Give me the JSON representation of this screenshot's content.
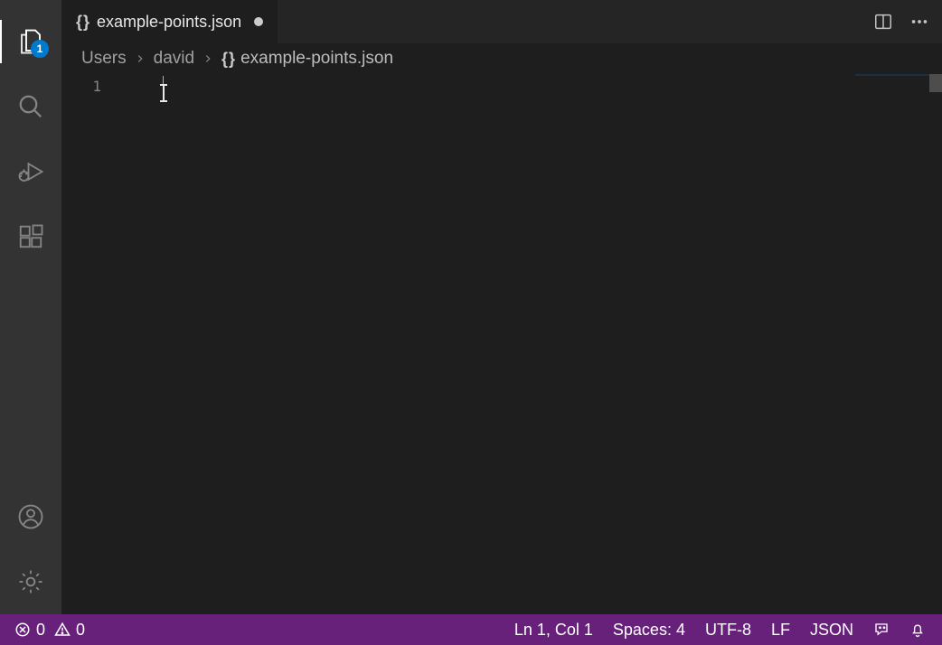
{
  "activityBar": {
    "explorerBadge": "1"
  },
  "tab": {
    "filename": "example-points.json"
  },
  "breadcrumb": {
    "seg1": "Users",
    "seg2": "david",
    "file": "example-points.json"
  },
  "editor": {
    "lineNumber1": "1",
    "content": ""
  },
  "statusBar": {
    "errors": "0",
    "warnings": "0",
    "lineCol": "Ln 1, Col 1",
    "spaces": "Spaces: 4",
    "encoding": "UTF-8",
    "eol": "LF",
    "language": "JSON"
  }
}
